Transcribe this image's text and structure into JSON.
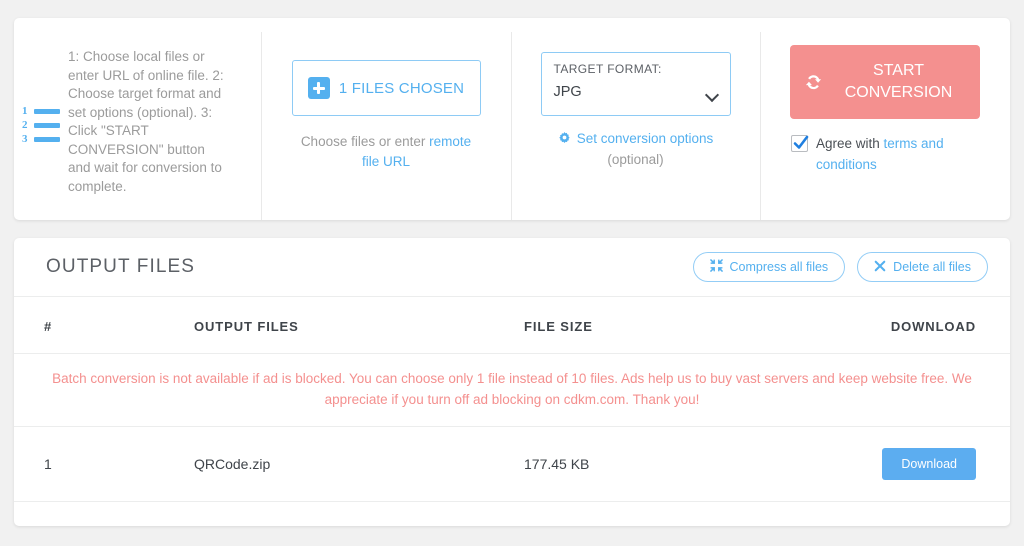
{
  "colors": {
    "accent_blue": "#54b0ef",
    "button_blue": "#5cadf0",
    "salmon": "#f4908f",
    "page_bg": "#f1f1f1",
    "text_gray": "#9b9b9b",
    "text_dark": "#3f444a"
  },
  "steps": {
    "icon": "ordered-list-icon",
    "numbers": [
      "1",
      "2",
      "3"
    ],
    "text": "1: Choose local files or enter URL of online file. 2: Choose target format and set options (optional). 3: Click \"START CONVERSION\" button and wait for conversion to complete."
  },
  "choose_files": {
    "icon": "plus-square-icon",
    "button_label": "1 FILES CHOSEN",
    "sub_prefix": "Choose files or enter ",
    "sub_link": "remote file URL"
  },
  "target_format": {
    "caption": "TARGET FORMAT:",
    "value": "JPG",
    "options": [
      "JPG"
    ],
    "chevron_icon": "chevron-down-icon",
    "options_icon": "gear-icon",
    "options_link": "Set conversion options",
    "optional_note": "(optional)"
  },
  "start": {
    "icon": "sync-icon",
    "button_label": "START CONVERSION",
    "agree_prefix": "Agree with ",
    "agree_link": "terms and conditions",
    "checked": true
  },
  "output": {
    "title": "OUTPUT FILES",
    "compress_icon": "compress-icon",
    "compress_label": "Compress all files",
    "delete_icon": "close-x-icon",
    "delete_label": "Delete all files",
    "columns": {
      "num": "#",
      "name": "OUTPUT FILES",
      "size": "FILE SIZE",
      "download": "DOWNLOAD"
    },
    "notice": "Batch conversion is not available if ad is blocked. You can choose only 1 file instead of 10 files. Ads help us to buy vast servers and keep website free. We appreciate if you turn off ad blocking on cdkm.com. Thank you!",
    "rows": [
      {
        "num": "1",
        "name": "QRCode.zip",
        "size": "177.45 KB",
        "download_label": "Download"
      }
    ]
  }
}
